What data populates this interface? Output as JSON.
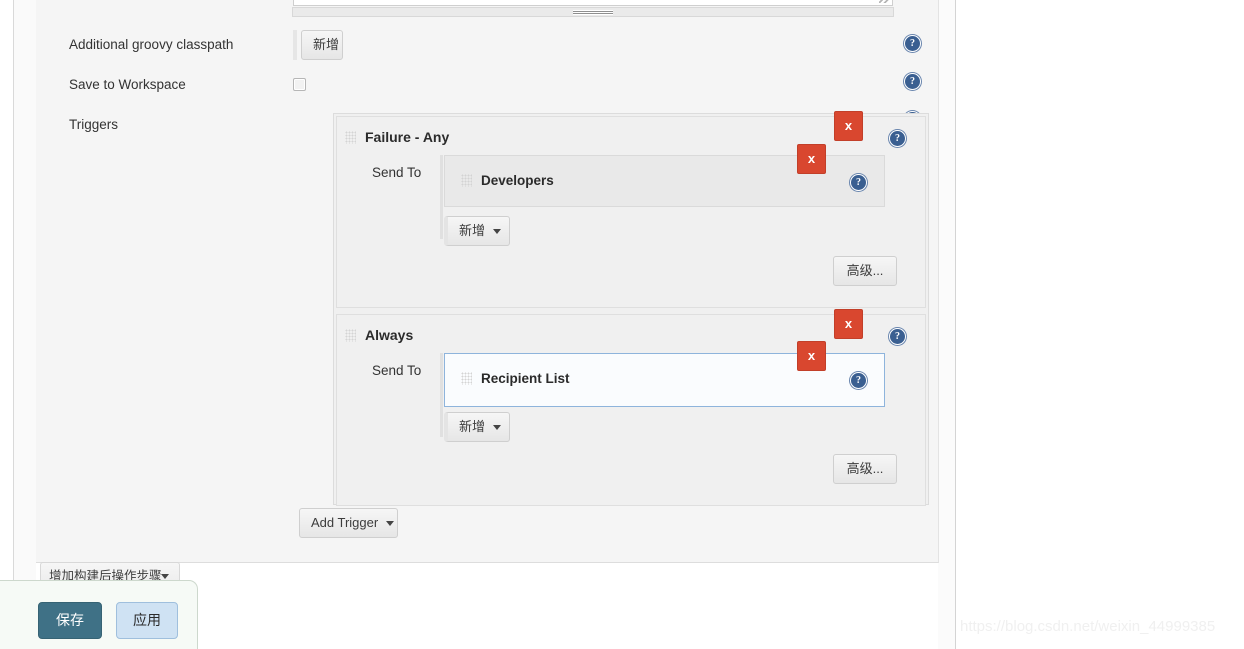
{
  "form": {
    "rows": [
      {
        "label": "Additional groovy classpath",
        "button": "新增",
        "help": "?"
      },
      {
        "label": "Save to Workspace",
        "help": "?"
      },
      {
        "label": "Triggers",
        "help": "?"
      }
    ]
  },
  "triggers": {
    "items": [
      {
        "name": "Failure - Any",
        "remove": "x",
        "help": "?",
        "send_to_label": "Send To",
        "recipients": [
          {
            "name": "Developers",
            "remove": "x",
            "help": "?",
            "focused": false
          }
        ],
        "add_label": "新增",
        "advanced_label": "高级..."
      },
      {
        "name": "Always",
        "remove": "x",
        "help": "?",
        "send_to_label": "Send To",
        "recipients": [
          {
            "name": "Recipient List",
            "remove": "x",
            "help": "?",
            "focused": true
          }
        ],
        "add_label": "新增",
        "advanced_label": "高级..."
      }
    ],
    "add_trigger_label": "Add Trigger"
  },
  "post_build": {
    "add_step_label": "增加构建后操作步骤"
  },
  "save_bar": {
    "save_label": "保存",
    "apply_label": "应用"
  },
  "watermark": {
    "text": "https://blog.csdn.net/weixin_44999385"
  },
  "colors": {
    "danger": "#d9472f",
    "help_blue": "#3a5f91",
    "primary": "#3f7186",
    "secondary": "#cfe2f3",
    "focus_border": "#8eb4dc",
    "panel_bg": "#f5f5f5"
  }
}
